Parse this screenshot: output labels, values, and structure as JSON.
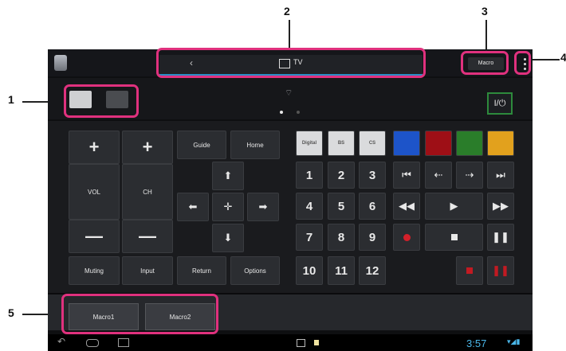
{
  "callouts": [
    "1",
    "2",
    "3",
    "4",
    "5"
  ],
  "status": {
    "source_label": "TV",
    "macro_label": "Macro",
    "time": "3:57"
  },
  "toolbar": {
    "power_label": "I/⏻"
  },
  "remote": {
    "vol_label": "VOL",
    "ch_label": "CH",
    "plus": "+",
    "minus": "—",
    "guide": "Guide",
    "home": "Home",
    "muting": "Muting",
    "input": "Input",
    "return": "Return",
    "options": "Options",
    "digital": "Digital",
    "bs": "BS",
    "cs": "CS",
    "numbers": [
      "1",
      "2",
      "3",
      "4",
      "5",
      "6",
      "7",
      "8",
      "9",
      "10",
      "11",
      "12"
    ],
    "arrows": {
      "up": "⬆",
      "down": "⬇",
      "left": "⬅",
      "right": "➡",
      "center": "✛"
    },
    "transport": {
      "prev": "⏮",
      "rew_step": "⇠",
      "fwd_step": "⇢",
      "next": "⏭",
      "rewind": "◀◀",
      "play": "▶",
      "fastfwd": "▶▶",
      "pause": "❚❚"
    }
  },
  "macros": [
    "Macro1",
    "Macro2"
  ],
  "colors": {
    "blue": "#1d54c9",
    "red": "#9e0f16",
    "green": "#2a7d2a",
    "yellow": "#e2a11d",
    "accent": "#e0317e"
  }
}
